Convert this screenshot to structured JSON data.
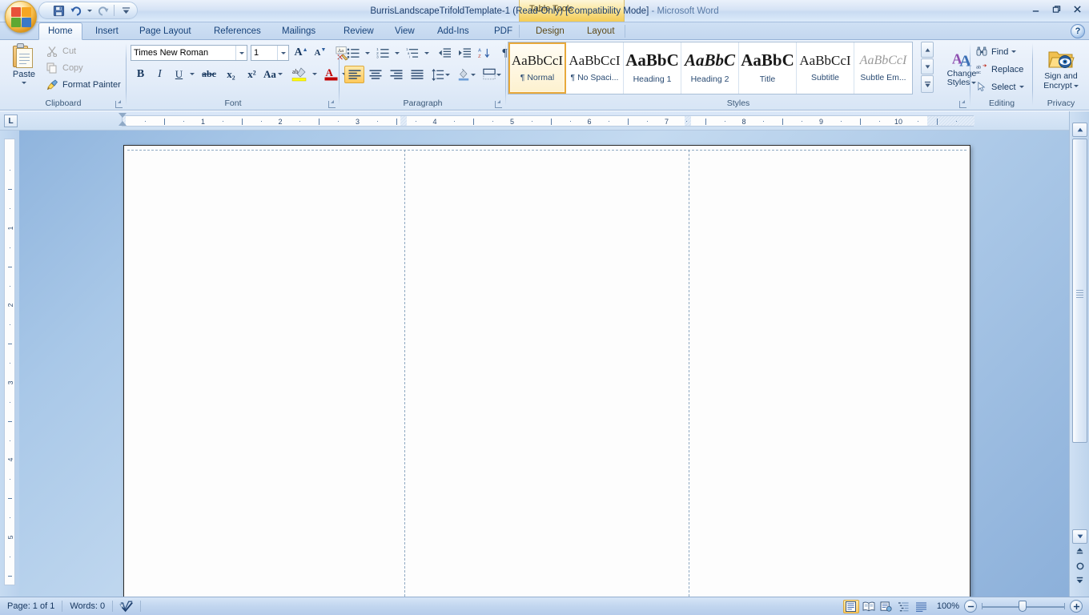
{
  "window": {
    "title": "BurrisLandscapeTrifoldTemplate-1 (Read-Only) [Compatibility Mode]",
    "title_sep": "-",
    "app_name": "Microsoft Word",
    "contextual_tab_group": "Table Tools",
    "minimize": "–",
    "restore": "❐",
    "close": "✕"
  },
  "quick_access": {
    "save": "Save",
    "undo": "Undo",
    "redo": "Redo",
    "customize": "Customize Quick Access Toolbar"
  },
  "tabs": [
    {
      "label": "Home",
      "active": true
    },
    {
      "label": "Insert",
      "active": false
    },
    {
      "label": "Page Layout",
      "active": false
    },
    {
      "label": "References",
      "active": false
    },
    {
      "label": "Mailings",
      "active": false
    },
    {
      "label": "Review",
      "active": false
    },
    {
      "label": "View",
      "active": false
    },
    {
      "label": "Add-Ins",
      "active": false
    },
    {
      "label": "PDF",
      "active": false
    },
    {
      "label": "Design",
      "active": false,
      "contextual": true
    },
    {
      "label": "Layout",
      "active": false,
      "contextual": true
    }
  ],
  "help": {
    "label": "?"
  },
  "ribbon": {
    "clipboard": {
      "group_label": "Clipboard",
      "paste": "Paste",
      "cut": "Cut",
      "copy": "Copy",
      "format_painter": "Format Painter"
    },
    "font": {
      "group_label": "Font",
      "font_name": "Times New Roman",
      "font_size": "1",
      "grow_font": "A",
      "shrink_font": "A",
      "clear_formatting": "Aa",
      "bold": "B",
      "italic": "I",
      "underline": "U",
      "strikethrough": "abc",
      "subscript": "x₂",
      "superscript": "x²",
      "change_case": "Aa",
      "highlight": "ab",
      "font_color": "A"
    },
    "paragraph": {
      "group_label": "Paragraph",
      "bullets": "Bullets",
      "numbering": "Numbering",
      "multilevel": "Multilevel List",
      "decrease_indent": "Decrease Indent",
      "increase_indent": "Increase Indent",
      "sort": "Sort",
      "show_marks": "¶",
      "align_left": "Align Text Left",
      "align_center": "Center",
      "align_right": "Align Text Right",
      "justify": "Justify",
      "line_spacing": "Line Spacing",
      "shading": "Shading",
      "borders": "Borders"
    },
    "styles": {
      "group_label": "Styles",
      "items": [
        {
          "preview": "AaBbCcI",
          "name": "¶ Normal",
          "selected": true,
          "size": "17px",
          "weight": "normal",
          "style": "normal",
          "color": "#1a1a1a"
        },
        {
          "preview": "AaBbCcI",
          "name": "¶ No Spaci...",
          "selected": false,
          "size": "17px",
          "weight": "normal",
          "style": "normal",
          "color": "#1a1a1a"
        },
        {
          "preview": "AaBbC",
          "name": "Heading 1",
          "selected": false,
          "size": "21px",
          "weight": "bold",
          "style": "normal",
          "color": "#1a1a1a"
        },
        {
          "preview": "AaBbC",
          "name": "Heading 2",
          "selected": false,
          "size": "21px",
          "weight": "bold",
          "style": "italic",
          "color": "#1a1a1a"
        },
        {
          "preview": "AaBbC",
          "name": "Title",
          "selected": false,
          "size": "21px",
          "weight": "bold",
          "style": "normal",
          "color": "#1a1a1a"
        },
        {
          "preview": "AaBbCcI",
          "name": "Subtitle",
          "selected": false,
          "size": "17px",
          "weight": "normal",
          "style": "normal",
          "color": "#1a1a1a"
        },
        {
          "preview": "AaBbCcI",
          "name": "Subtle Em...",
          "selected": false,
          "size": "16px",
          "weight": "normal",
          "style": "italic",
          "color": "#9a9a9a"
        }
      ],
      "scroll_up": "▲",
      "scroll_down": "▼",
      "more": "▬",
      "change_styles": "Change",
      "change_styles_2": "Styles"
    },
    "editing": {
      "group_label": "Editing",
      "find": "Find",
      "replace": "Replace",
      "select": "Select"
    },
    "privacy": {
      "group_label": "Privacy",
      "sign_and_encrypt": "Sign and",
      "sign_and_encrypt_2": "Encrypt"
    }
  },
  "ruler": {
    "tab_selector": "L",
    "horizontal_numbers": [
      "1",
      "2",
      "3",
      "4",
      "5",
      "6",
      "7",
      "8",
      "9",
      "10"
    ],
    "vertical_numbers": [
      "1",
      "2",
      "3",
      "4",
      "5"
    ]
  },
  "document": {
    "columns": 3,
    "page_background": "#fdfdfd"
  },
  "scrollbar": {
    "up": "▲",
    "down": "▼",
    "prev_page": "⥣",
    "select_browse_object": "○",
    "next_page": "⥥"
  },
  "statusbar": {
    "page": "Page: 1 of 1",
    "words": "Words: 0",
    "proofing": "Proofing errors",
    "views": [
      {
        "name": "print-layout",
        "selected": true
      },
      {
        "name": "full-screen-reading",
        "selected": false
      },
      {
        "name": "web-layout",
        "selected": false
      },
      {
        "name": "outline",
        "selected": false
      },
      {
        "name": "draft",
        "selected": false
      }
    ],
    "zoom_level": "100%",
    "zoom_out": "−",
    "zoom_in": "+"
  },
  "colors": {
    "accent": "#1d4f91",
    "highlight": "#ffc95c",
    "contextual": "#f3cc55",
    "font_color_red": "#c00000",
    "highlight_yellow": "#ffff00"
  }
}
